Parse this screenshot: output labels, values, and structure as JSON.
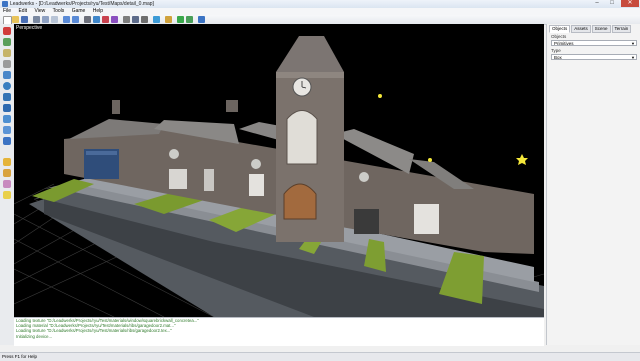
{
  "window": {
    "title": "Leadwerks - [D:/Leadwerks/Projects/ryu/Test/Maps/detail_0.map]",
    "min": "–",
    "max": "□",
    "close": "✕"
  },
  "menu": [
    "File",
    "Edit",
    "View",
    "Tools",
    "Game",
    "Help"
  ],
  "viewport": {
    "label": "Perspective"
  },
  "panel": {
    "tabs": [
      "Objects",
      "Assets",
      "Scene",
      "Terrain"
    ],
    "objects_label": "Objects",
    "objects_value": "Primitives",
    "type_label": "Type",
    "type_value": "Box"
  },
  "console": [
    "Loading texture \"D:/Leadwerks/Projects/ryu/Test/materials/window/squarebrickwall_concretea...\"",
    "Loading material \"D:/Leadwerks/Projects/ryu/Test/materials/ribs/garagedoor2.mat...\"",
    "Loading texture \"D:/Leadwerks/Projects/ryu/Test/materials/ribs/garagedoor2.tex...\"",
    "Initializing device..."
  ],
  "status": "Press F1 for Help",
  "colors": {
    "accent": "#3c74c4",
    "console_text": "#2e7a2a",
    "close_button": "#c74b3d"
  }
}
